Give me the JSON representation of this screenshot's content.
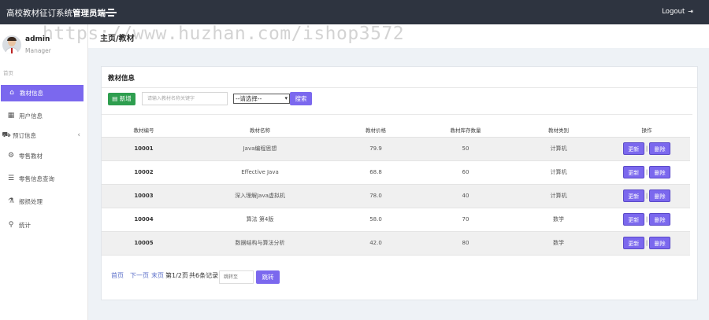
{
  "app": {
    "title_prefix": "高校教材征订系统",
    "title_role": "管理员端",
    "logout_label": "Logout"
  },
  "user": {
    "name": "admin",
    "role": "Manager"
  },
  "sidebar": {
    "home_label": "首页",
    "items": [
      {
        "label": "教材信息",
        "icon": "home-icon",
        "active": true
      },
      {
        "label": "用户信息",
        "icon": "grid-icon"
      },
      {
        "label": "预订信息",
        "icon": "cart-icon",
        "has_children": true
      },
      {
        "label": "零售教材",
        "icon": "gear-icon"
      },
      {
        "label": "零售信息查询",
        "icon": "list-icon"
      },
      {
        "label": "报损处理",
        "icon": "flask-icon"
      },
      {
        "label": "统计",
        "icon": "search-icon"
      }
    ]
  },
  "watermark": "https://www.huzhan.com/ishop3572",
  "breadcrumb": {
    "title": "主页/教材"
  },
  "panel": {
    "title": "教材信息",
    "add_label": "新增",
    "search_placeholder": "请输入教材名称关键字",
    "select_value": "--请选择--",
    "search_label": "搜索"
  },
  "table": {
    "headers": [
      "教材编号",
      "教材名称",
      "教材价格",
      "教材库存数量",
      "教材类别",
      "操作"
    ],
    "rows": [
      {
        "id": "10001",
        "name": "Java编程思想",
        "price": "79.9",
        "stock": "50",
        "category": "计算机"
      },
      {
        "id": "10002",
        "name": "Effective Java",
        "price": "68.8",
        "stock": "60",
        "category": "计算机"
      },
      {
        "id": "10003",
        "name": "深入理解Java虚拟机",
        "price": "78.0",
        "stock": "40",
        "category": "计算机"
      },
      {
        "id": "10004",
        "name": "算法 第4版",
        "price": "58.0",
        "stock": "70",
        "category": "数学"
      },
      {
        "id": "10005",
        "name": "数据结构与算法分析",
        "price": "42.0",
        "stock": "80",
        "category": "数学"
      }
    ],
    "update_label": "更新",
    "delete_label": "删除",
    "separator": "|"
  },
  "pager": {
    "first": "首页",
    "next": "下一页",
    "last": "末页",
    "page_info": "第1/2页",
    "total_info": "共6条记录",
    "jump_placeholder": "跳转至",
    "jump_label": "跳转"
  },
  "colors": {
    "topbar": "#2e3440",
    "accent": "#7b68ee",
    "add_button": "#2e9e4f",
    "link": "#5a6ec8"
  }
}
